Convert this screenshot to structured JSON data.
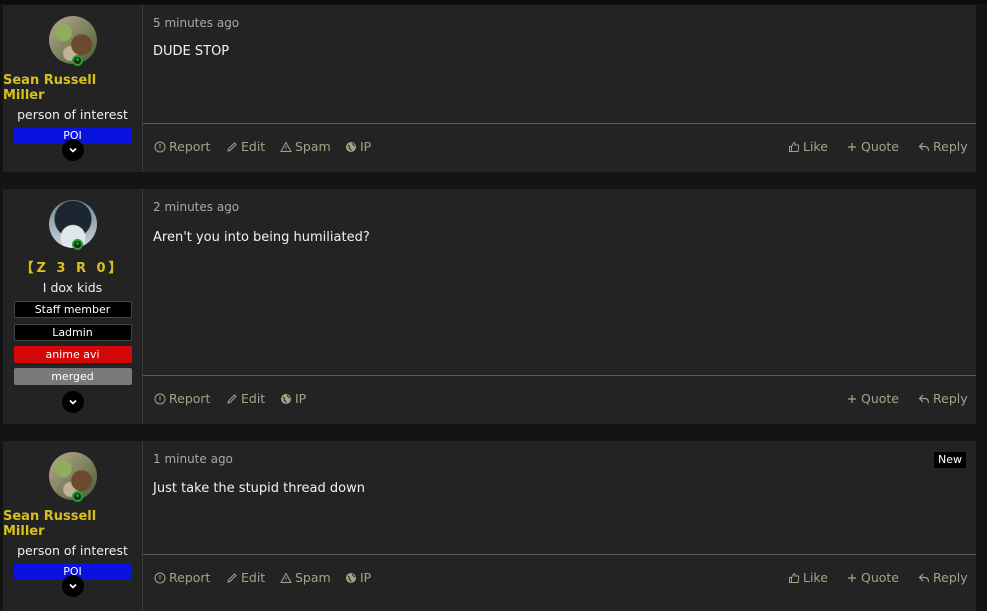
{
  "posts": [
    {
      "user": {
        "name": "Sean Russell Miller",
        "title": "person of interest",
        "banners": [
          "POI"
        ]
      },
      "time": "5 minutes ago",
      "message": "DUDE STOP",
      "actions_left": [
        "Report",
        "Edit",
        "Spam",
        "IP"
      ],
      "actions_right": [
        "Like",
        "Quote",
        "Reply"
      ]
    },
    {
      "user": {
        "name": "【Z 3 R 0】",
        "title": "I dox kids",
        "banners": [
          "Staff member",
          "Ladmin",
          "anime avi",
          "merged"
        ]
      },
      "time": "2 minutes ago",
      "message": "Aren't you into being humiliated?",
      "actions_left": [
        "Report",
        "Edit",
        "IP"
      ],
      "actions_right": [
        "Quote",
        "Reply"
      ]
    },
    {
      "user": {
        "name": "Sean Russell Miller",
        "title": "person of interest",
        "banners": [
          "POI"
        ]
      },
      "time": "1 minute ago",
      "badge": "New",
      "message": "Just take the stupid thread down",
      "actions_left": [
        "Report",
        "Edit",
        "Spam",
        "IP"
      ],
      "actions_right": [
        "Like",
        "Quote",
        "Reply"
      ]
    }
  ],
  "icons": {
    "report": "info-circle-icon",
    "edit": "pencil-icon",
    "spam": "warning-triangle-icon",
    "ip": "globe-icon",
    "like": "thumbs-up-icon",
    "quote": "plus-icon",
    "reply": "reply-arrow-icon",
    "expand": "chevron-down-icon"
  },
  "colors": {
    "username": "#d8c01c",
    "action_text": "#a6a28a",
    "banner_poi": "#0a12e0",
    "banner_anime": "#d30707",
    "banner_merged": "#7a7a7a",
    "online_indicator": "#23a12f"
  }
}
